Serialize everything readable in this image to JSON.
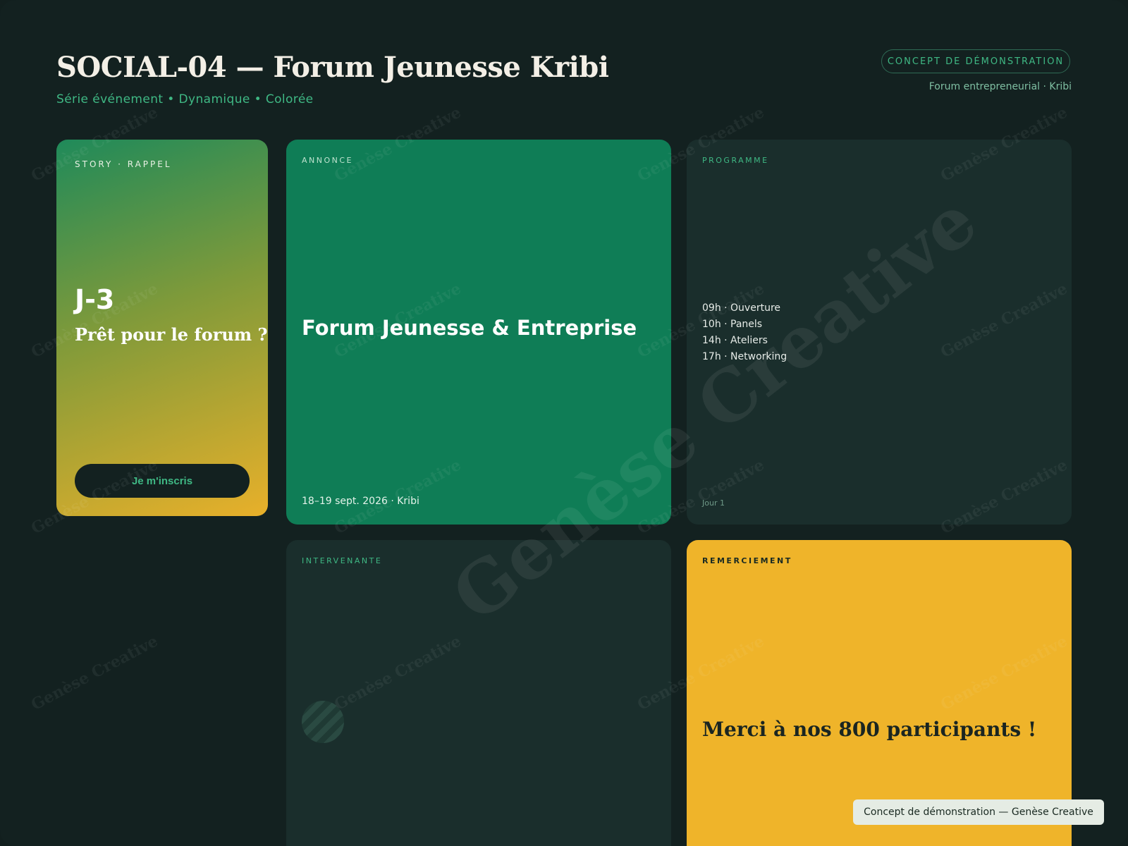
{
  "header": {
    "title": "SOCIAL-04 — Forum Jeunesse Kribi",
    "subtitle": "Série événement • Dynamique • Colorée",
    "badge": "CONCEPT DE DÉMONSTRATION",
    "meta": "Forum entrepreneurial · Kribi"
  },
  "story": {
    "label": "STORY · RAPPEL",
    "countdown": "J-3",
    "text": "Prêt pour le forum ?",
    "cta": "Je m'inscris"
  },
  "annonce": {
    "label": "ANNONCE",
    "title": "Forum Jeunesse & Entreprise",
    "date": "18–19 sept. 2026 · Kribi"
  },
  "programme": {
    "label": "PROGRAMME",
    "items": [
      "09h · Ouverture",
      "10h · Panels",
      "14h · Ateliers",
      "17h · Networking"
    ],
    "footer": "Jour 1"
  },
  "intervenante": {
    "label": "INTERVENANTE"
  },
  "remerciement": {
    "label": "REMERCIEMENT",
    "text": "Merci à nos 800 participants !"
  },
  "watermark": {
    "text": "Genèse Creative"
  },
  "toast": {
    "text": "Concept de démonstration — Genèse Creative"
  },
  "colors": {
    "background": "#132120",
    "accent": "#3fb884",
    "green_card": "#0f7d56",
    "dark_card": "#1a2e2c",
    "yellow_card": "#efb42a"
  }
}
